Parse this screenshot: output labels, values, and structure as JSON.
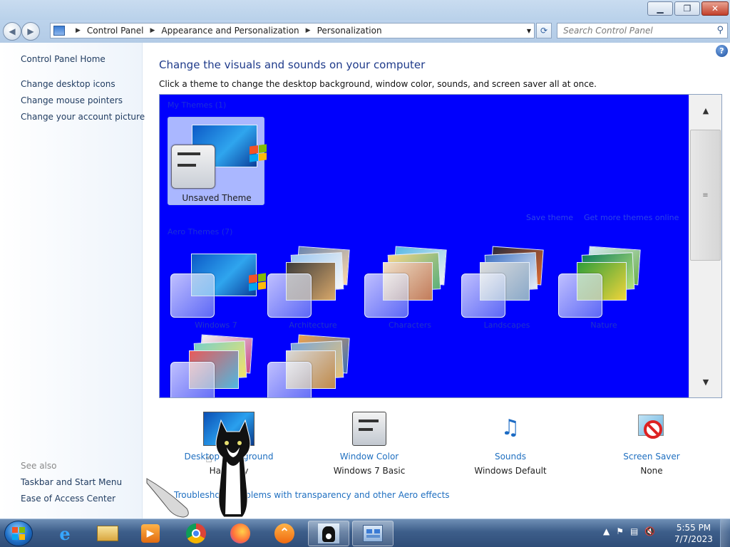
{
  "window": {
    "minimize_icon": "minimize-icon",
    "maximize_icon": "restore-icon",
    "close_icon": "close-icon"
  },
  "address": {
    "crumbs": [
      "Control Panel",
      "Appearance and Personalization",
      "Personalization"
    ],
    "search_placeholder": "Search Control Panel"
  },
  "left_pane": {
    "home": "Control Panel Home",
    "links": [
      "Change desktop icons",
      "Change mouse pointers",
      "Change your account picture"
    ],
    "see_also_label": "See also",
    "see_also": [
      "Taskbar and Start Menu",
      "Ease of Access Center"
    ]
  },
  "main": {
    "heading": "Change the visuals and sounds on your computer",
    "subtext": "Click a theme to change the desktop background, window color, sounds, and screen saver all at once.",
    "help_label": "?",
    "my_themes_label": "My Themes (1)",
    "aero_themes_label": "Aero Themes (7)",
    "save_theme": "Save theme",
    "get_more": "Get more themes online",
    "my_themes": [
      "Unsaved Theme"
    ],
    "aero_themes": [
      "Windows 7",
      "Architecture",
      "Characters",
      "Landscapes",
      "Nature",
      "",
      ""
    ]
  },
  "settings": {
    "desktop_background": {
      "label": "Desktop Background",
      "value": "Harmony"
    },
    "window_color": {
      "label": "Window Color",
      "value": "Windows 7 Basic"
    },
    "sounds": {
      "label": "Sounds",
      "value": "Windows Default"
    },
    "screen_saver": {
      "label": "Screen Saver",
      "value": "None"
    }
  },
  "troubleshoot": "Troubleshoot problems with transparency and other Aero effects",
  "taskbar": {
    "time": "5:55 PM",
    "date": "7/7/2023",
    "items": [
      "internet-explorer-icon",
      "file-explorer-icon",
      "media-player-icon",
      "chrome-icon",
      "firefox-icon",
      "app-icon",
      "cat-app-icon",
      "control-panel-icon"
    ]
  },
  "colors": {
    "theme_area_bg": "#0000fd",
    "link": "#1f6fc0",
    "heading": "#1e3a8a"
  }
}
